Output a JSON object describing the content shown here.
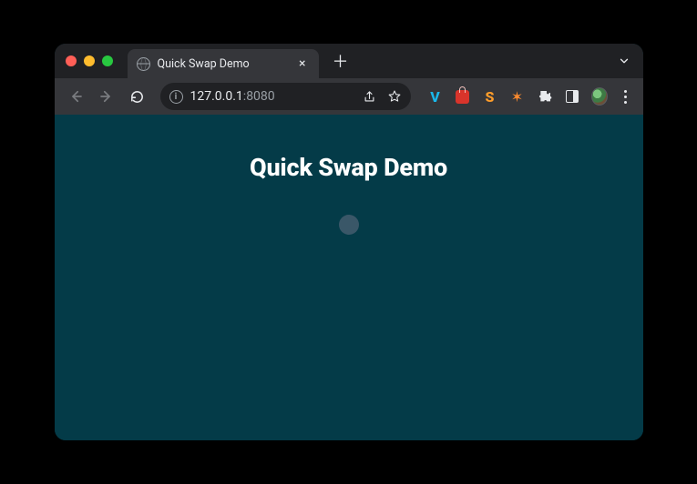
{
  "tabbar": {
    "tab_title": "Quick Swap Demo"
  },
  "toolbar": {
    "url_host": "127.0.0.1",
    "url_port": ":8080"
  },
  "page": {
    "title": "Quick Swap Demo"
  }
}
